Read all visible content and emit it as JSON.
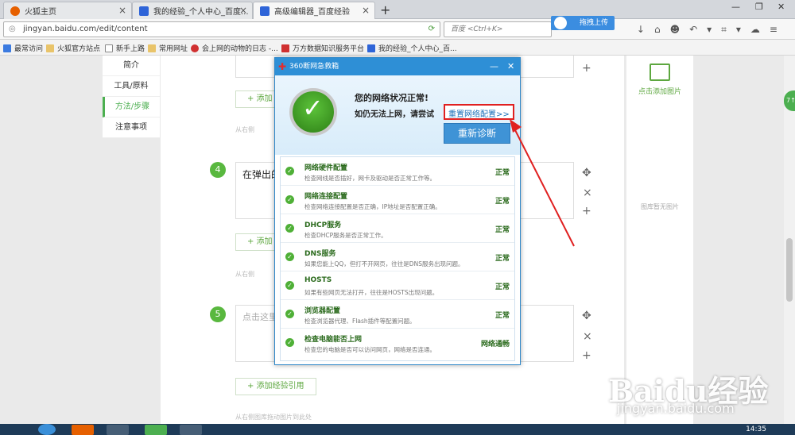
{
  "browser": {
    "tabs": [
      {
        "label": "火狐主页",
        "color": "#e66000"
      },
      {
        "label": "我的经验_个人中心_百度...",
        "color": "#2e64d8"
      },
      {
        "label": "高级编辑器_百度经验",
        "color": "#2e64d8"
      }
    ],
    "new_tab": "+",
    "window_buttons": [
      "—",
      "❐",
      "✕"
    ],
    "url": "jingyan.baidu.com/edit/content",
    "search_placeholder": "百度 <Ctrl+K>",
    "upload_button": "拖拽上传",
    "toolbar_icons": "↓⌂☻↶▾⌗▾☁≡"
  },
  "bookmarks": [
    {
      "label": "最常访问"
    },
    {
      "label": "火狐官方站点"
    },
    {
      "label": "新手上路"
    },
    {
      "label": "常用网址"
    },
    {
      "label": "会上网的动物的日志 -..."
    },
    {
      "label": "万方数据知识服务平台"
    },
    {
      "label": "我的经验_个人中心_百..."
    }
  ],
  "sidebar": {
    "items": [
      {
        "label": "简介"
      },
      {
        "label": "工具/原料"
      },
      {
        "label": "方法/步骤"
      },
      {
        "label": "注意事项"
      }
    ]
  },
  "editor": {
    "add_label_short": "+ 添加",
    "add_label_full": "+ 添加经验引用",
    "hint_short": "从右侧",
    "hint_full": "从右侧图库拖动图片到此处",
    "step4_number": "4",
    "step4_text": "在弹出的",
    "step5_number": "5",
    "step5_placeholder": "点击这里",
    "move_icon": "✥",
    "close_icon": "×",
    "plus_icon": "+"
  },
  "right_panel": {
    "add_image": "点击添加图片",
    "no_image": "图库暂无图片"
  },
  "green_badge": "7↑",
  "dialog": {
    "title": "360断网急救箱",
    "status_title": "您的网络状况正常!",
    "status_sub": "如仍无法上网，请尝试",
    "reset_link": "重置网络配置>>",
    "rediagnose": "重新诊断",
    "min_icon": "—",
    "close_icon": "✕",
    "items": [
      {
        "title": "网络硬件配置",
        "desc": "检查网线是否插好，网卡及驱动是否正常工作等。",
        "status": "正常"
      },
      {
        "title": "网络连接配置",
        "desc": "检查网络连接配置是否正确，IP地址是否配置正确。",
        "status": "正常"
      },
      {
        "title": "DHCP服务",
        "desc": "检查DHCP服务是否正常工作。",
        "status": "正常"
      },
      {
        "title": "DNS服务",
        "desc": "如果您能上QQ，但打不开网页，往往是DNS服务出现问题。",
        "status": "正常"
      },
      {
        "title": "HOSTS",
        "desc": "如果有些网页无法打开，往往是HOSTS出现问题。",
        "status": "正常"
      },
      {
        "title": "浏览器配置",
        "desc": "检查浏览器代理、Flash插件等配置问题。",
        "status": "正常"
      },
      {
        "title": "检查电脑能否上网",
        "desc": "检查您的电脑是否可以访问网页，网络是否连通。",
        "status": "网络通畅"
      }
    ]
  },
  "watermark": {
    "logo": "Baidu经验",
    "url": "jingyan.baidu.com"
  },
  "taskbar": {
    "clock": "14:35"
  }
}
